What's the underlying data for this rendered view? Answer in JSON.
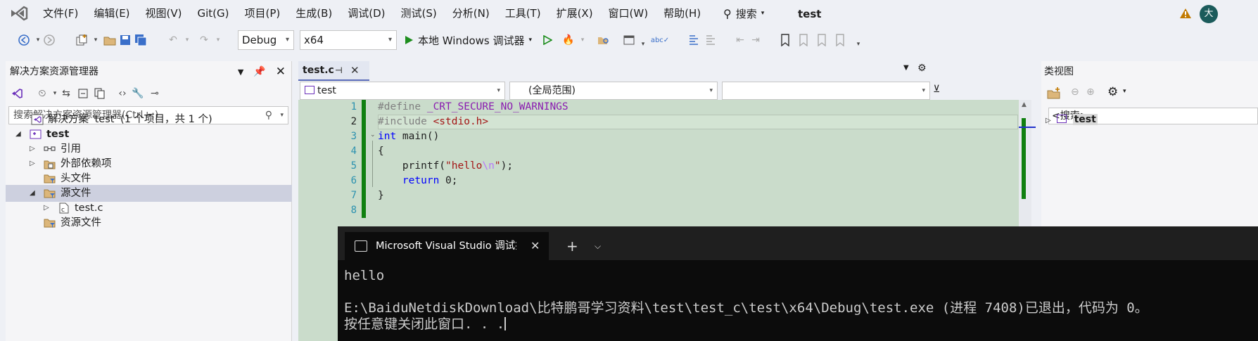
{
  "menubar": {
    "items": [
      "文件(F)",
      "编辑(E)",
      "视图(V)",
      "Git(G)",
      "项目(P)",
      "生成(B)",
      "调试(D)",
      "测试(S)",
      "分析(N)",
      "工具(T)",
      "扩展(X)",
      "窗口(W)",
      "帮助(H)"
    ],
    "search_label": "搜索",
    "project_name": "test",
    "avatar_initial": "大"
  },
  "toolbar": {
    "config": "Debug",
    "platform": "x64",
    "run_label": "本地 Windows 调试器"
  },
  "solution_explorer": {
    "title": "解决方案资源管理器",
    "search_placeholder": "搜索解决方案资源管理器(Ctrl+;)",
    "tree": [
      {
        "label": "解决方案 'test' (1 个项目，共 1 个)",
        "level": 0,
        "expander": "",
        "icon": "solution-icon"
      },
      {
        "label": "test",
        "level": 1,
        "expander": "◢",
        "icon": "project-icon",
        "bold": true
      },
      {
        "label": "引用",
        "level": 2,
        "expander": "▷",
        "icon": "references-icon"
      },
      {
        "label": "外部依赖项",
        "level": 2,
        "expander": "▷",
        "icon": "external-deps-icon"
      },
      {
        "label": "头文件",
        "level": 2,
        "expander": "",
        "icon": "filter-folder-icon"
      },
      {
        "label": "源文件",
        "level": 2,
        "expander": "◢",
        "icon": "filter-folder-icon",
        "selected": true
      },
      {
        "label": "test.c",
        "level": 3,
        "expander": "▷",
        "icon": "c-file-icon"
      },
      {
        "label": "资源文件",
        "level": 2,
        "expander": "",
        "icon": "filter-folder-icon"
      }
    ]
  },
  "editor": {
    "tab_label": "test.c",
    "nav_project": "test",
    "nav_scope": "(全局范围)",
    "nav_member": "",
    "line_numbers": [
      "1",
      "2",
      "3",
      "4",
      "5",
      "6",
      "7",
      "8"
    ]
  },
  "console": {
    "title": "Microsoft Visual Studio 调试控制台",
    "lines": [
      "hello",
      "",
      "E:\\BaiduNetdiskDownload\\比特鹏哥学习资料\\test\\test_c\\test\\x64\\Debug\\test.exe (进程 7408)已退出，代码为 0。",
      "按任意键关闭此窗口. . ."
    ]
  },
  "class_view": {
    "title": "类视图",
    "search_placeholder": "<搜索>",
    "tree_root": "test"
  },
  "colors": {
    "accent": "#5a6ab8",
    "editor_bg": "#cadccb",
    "change_bar": "#108010",
    "console_bg": "#0c0c0c"
  }
}
